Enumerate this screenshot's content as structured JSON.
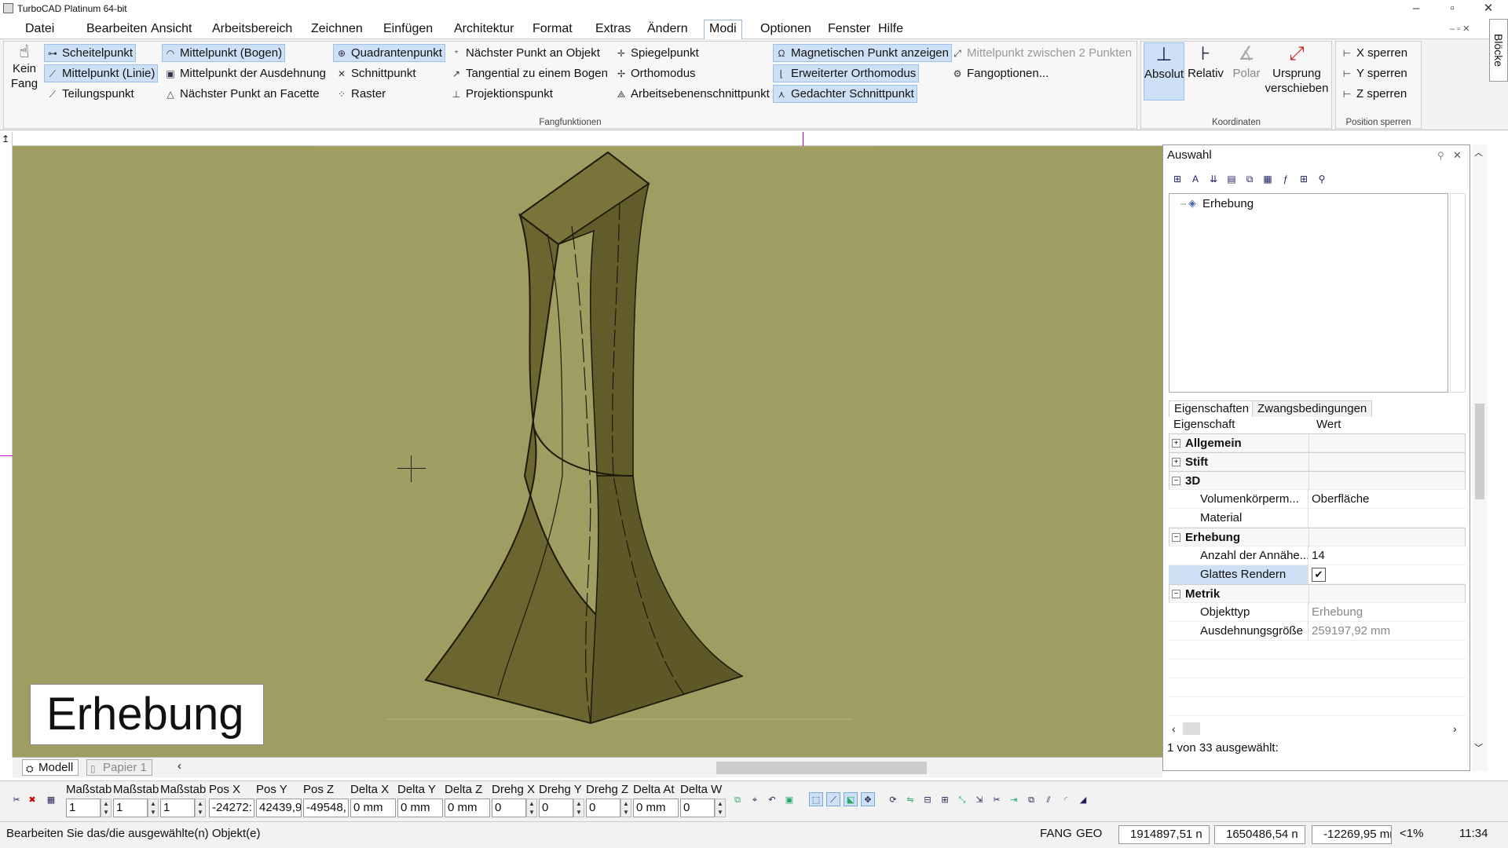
{
  "window": {
    "title": "TurboCAD  Platinum 64-bit"
  },
  "menu": [
    "Datei",
    "Bearbeiten",
    "Ansicht",
    "Arbeitsbereich",
    "Zeichnen",
    "Einfügen",
    "Architektur",
    "Format",
    "Extras",
    "Ändern",
    "Modi",
    "Optionen",
    "Fenster",
    "Hilfe"
  ],
  "menu_active": "Modi",
  "ribbon": {
    "snap_group_label": "Fangfunktionen",
    "no_snap": {
      "line1": "Kein",
      "line2": "Fang"
    },
    "snap_items": [
      {
        "label": "Scheitelpunkt",
        "icon": "vertex-snap-icon"
      },
      {
        "label": "Mittelpunkt (Linie)",
        "icon": "midpoint-line-icon"
      },
      {
        "label": "Teilungspunkt",
        "icon": "division-point-icon"
      },
      {
        "label": "Mittelpunkt (Bogen)",
        "icon": "midpoint-arc-icon"
      },
      {
        "label": "Mittelpunkt der Ausdehnung",
        "icon": "extent-center-icon"
      },
      {
        "label": "Nächster Punkt an Facette",
        "icon": "facet-nearest-icon"
      },
      {
        "label": "Quadrantenpunkt",
        "icon": "quadrant-icon"
      },
      {
        "label": "Schnittpunkt",
        "icon": "intersection-icon"
      },
      {
        "label": "Raster",
        "icon": "grid-icon"
      },
      {
        "label": "Nächster Punkt an Objekt",
        "icon": "nearest-object-icon"
      },
      {
        "label": "Tangential zu einem Bogen",
        "icon": "tangent-arc-icon"
      },
      {
        "label": "Projektionspunkt",
        "icon": "projection-icon"
      },
      {
        "label": "Spiegelpunkt",
        "icon": "mirror-point-icon"
      },
      {
        "label": "Orthomodus",
        "icon": "ortho-icon"
      },
      {
        "label": "Arbeitsebenenschnittpunkt",
        "icon": "workplane-intersection-icon"
      },
      {
        "label": "Magnetischen Punkt anzeigen",
        "icon": "magnet-icon"
      },
      {
        "label": "Erweiterter Orthomodus",
        "icon": "extended-ortho-icon"
      },
      {
        "label": "Gedachter Schnittpunkt",
        "icon": "apparent-intersection-icon"
      },
      {
        "label": "Mittelpunkt zwischen 2 Punkten",
        "icon": "midpoint-two-icon"
      },
      {
        "label": "Fangoptionen...",
        "icon": "snap-options-icon"
      }
    ],
    "coord_group_label": "Koordinaten",
    "coord_buttons": [
      {
        "label": "Absolut"
      },
      {
        "label": "Relativ"
      },
      {
        "label": "Polar"
      },
      {
        "label": "Ursprung verschieben",
        "line1": "Ursprung",
        "line2": "verschieben"
      }
    ],
    "lock_group_label": "Position sperren",
    "lock_items": [
      "X sperren",
      "Y sperren",
      "Z sperren"
    ]
  },
  "viewport": {
    "stamp_label": "Erhebung"
  },
  "sheet_tabs": [
    {
      "label": "Modell"
    },
    {
      "label": "Papier 1"
    }
  ],
  "panel": {
    "title": "Auswahl",
    "tree_item": "Erhebung",
    "tabs": [
      "Eigenschaften",
      "Zwangsbedingungen"
    ],
    "col_property": "Eigenschaft",
    "col_value": "Wert",
    "rows": [
      {
        "name": "Allgemein",
        "value": "",
        "kind": "group",
        "exp": "+"
      },
      {
        "name": "Stift",
        "value": "",
        "kind": "group",
        "exp": "+"
      },
      {
        "name": "3D",
        "value": "",
        "kind": "group",
        "exp": "−"
      },
      {
        "name": "Volumenkörperm...",
        "value": "Oberfläche",
        "kind": "sub"
      },
      {
        "name": "Material",
        "value": "",
        "kind": "sub"
      },
      {
        "name": "Erhebung",
        "value": "",
        "kind": "group",
        "exp": "−"
      },
      {
        "name": "Anzahl der Annähe...",
        "value": "14",
        "kind": "sub"
      },
      {
        "name": "Glattes Rendern",
        "value": "✔",
        "kind": "sub"
      },
      {
        "name": "Metrik",
        "value": "",
        "kind": "group",
        "exp": "−"
      },
      {
        "name": "Objekttyp",
        "value": "Erhebung",
        "kind": "ro"
      },
      {
        "name": "Ausdehnungsgröße",
        "value": "259197,92 mm",
        "kind": "ro"
      }
    ],
    "selection_count": "1 von 33 ausgewählt:"
  },
  "right_tab": "Blöcke",
  "inspector": {
    "fields": [
      {
        "label": "Maßstab",
        "value": "1"
      },
      {
        "label": "Maßstab",
        "value": "1"
      },
      {
        "label": "Maßstab",
        "value": "1"
      },
      {
        "label": "Pos X",
        "value": "-24272:"
      },
      {
        "label": "Pos Y",
        "value": "42439,9"
      },
      {
        "label": "Pos Z",
        "value": "-49548,"
      },
      {
        "label": "Delta X",
        "value": "0 mm"
      },
      {
        "label": "Delta Y",
        "value": "0 mm"
      },
      {
        "label": "Delta Z",
        "value": "0 mm"
      },
      {
        "label": "Drehg X",
        "value": "0"
      },
      {
        "label": "Drehg Y",
        "value": "0"
      },
      {
        "label": "Drehg Z",
        "value": "0"
      },
      {
        "label": "Delta At",
        "value": "0 mm"
      },
      {
        "label": "Delta W",
        "value": "0"
      }
    ]
  },
  "status": {
    "message": "Bearbeiten Sie das/die ausgewählte(n) Objekt(e)",
    "fang": "FANG",
    "geo": "GEO",
    "x": "1914897,51 n",
    "y": "1650486,54 n",
    "z": "-12269,95 mr",
    "zoom": "<1%",
    "time": "11:34"
  }
}
